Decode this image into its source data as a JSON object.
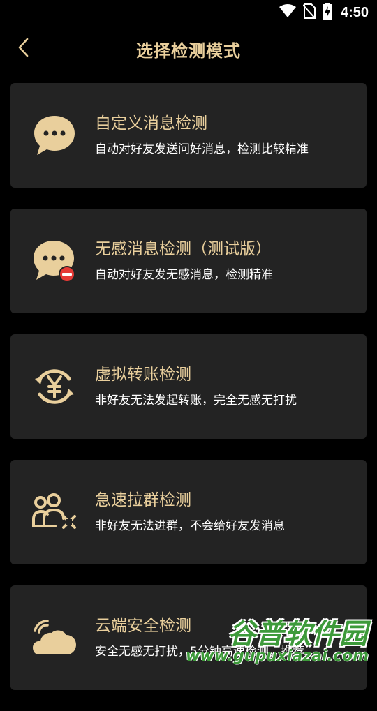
{
  "status_bar": {
    "time": "4:50",
    "icons": [
      "wifi-icon",
      "no-sim-icon",
      "battery-charging-icon"
    ]
  },
  "header": {
    "title": "选择检测模式",
    "back_icon": "chevron-left-icon"
  },
  "modes": [
    {
      "title": "自定义消息检测",
      "desc": "自动对好友发送问好消息，检测比较精准",
      "icon": "chat-bubble-icon"
    },
    {
      "title": "无感消息检测（测试版）",
      "desc": "自动对好友发无感消息，检测精准",
      "icon": "chat-bubble-blocked-icon"
    },
    {
      "title": "虚拟转账检测",
      "desc": "非好友无法发起转账，完全无感无打扰",
      "icon": "yuan-transfer-icon"
    },
    {
      "title": "急速拉群检测",
      "desc": "非好友无法进群，不会给好友发消息",
      "icon": "group-users-icon"
    },
    {
      "title": "云端安全检测",
      "desc": "安全无感无打扰，5分钟高速检测，推荐",
      "icon": "cloud-signal-icon"
    }
  ],
  "watermark": {
    "title": "谷普软件园",
    "url": "www.gupuxiazai.com"
  },
  "colors": {
    "background": "#000000",
    "card": "#232323",
    "accent_gold": "#e9cf9c",
    "badge_red": "#e53935",
    "watermark_green": "#3d9a3a"
  }
}
